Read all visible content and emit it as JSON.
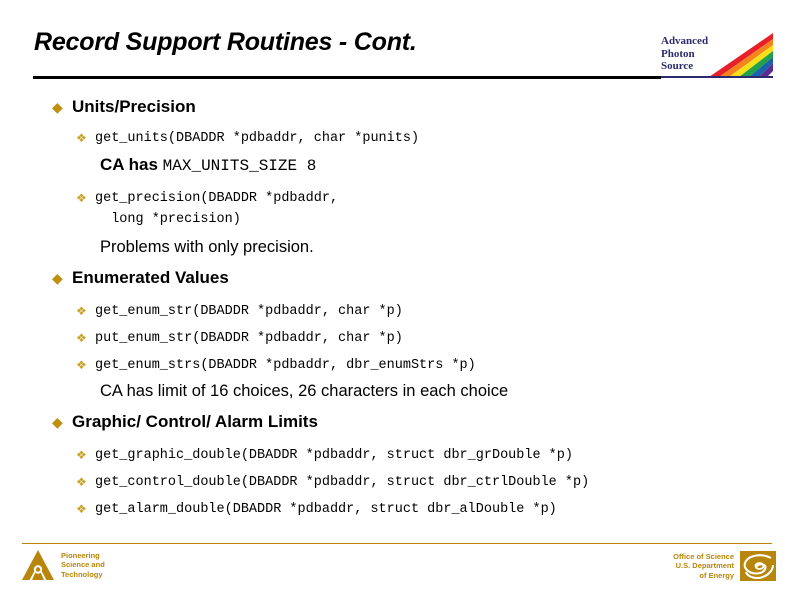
{
  "header": {
    "title": "Record Support Routines - Cont.",
    "logo": {
      "line1": "Advanced",
      "line2": "Photon",
      "line3": "Source",
      "icon": "aps-rainbow-icon"
    }
  },
  "bullets": {
    "level1_glyph": "◆",
    "level2_glyph": "❖",
    "level1_color": "#bf8f10",
    "level2_color": "#c9a227"
  },
  "sections": [
    {
      "heading": "Units/Precision",
      "items": [
        {
          "type": "code",
          "text": "get_units(DBADDR *pdbaddr, char *punits)"
        },
        {
          "type": "note-mixed",
          "lead": "CA has ",
          "mono": "MAX_UNITS_SIZE 8"
        },
        {
          "type": "code-wrap",
          "text": "get_precision(DBADDR *pdbaddr,\n  long *precision)"
        },
        {
          "type": "note",
          "text": "Problems with only precision."
        }
      ]
    },
    {
      "heading": "Enumerated Values",
      "items": [
        {
          "type": "code",
          "text": "get_enum_str(DBADDR *pdbaddr, char *p)"
        },
        {
          "type": "code",
          "text": "put_enum_str(DBADDR *pdbaddr, char *p)"
        },
        {
          "type": "code",
          "text": "get_enum_strs(DBADDR *pdbaddr, dbr_enumStrs *p)"
        },
        {
          "type": "note",
          "text": "CA has limit of 16 choices, 26 characters in each choice"
        }
      ]
    },
    {
      "heading": "Graphic/ Control/ Alarm Limits",
      "items": [
        {
          "type": "code",
          "text": "get_graphic_double(DBADDR *pdbaddr, struct dbr_grDouble *p)"
        },
        {
          "type": "code",
          "text": "get_control_double(DBADDR *pdbaddr, struct dbr_ctrlDouble *p)"
        },
        {
          "type": "code",
          "text": "get_alarm_double(DBADDR *pdbaddr, struct dbr_alDouble *p)"
        }
      ]
    }
  ],
  "footer": {
    "argonne": {
      "icon": "argonne-a-icon",
      "text": "Pioneering\nScience and\nTechnology"
    },
    "doe": {
      "icon": "doe-swirl-icon",
      "text": "Office of Science\nU.S. Department\nof Energy"
    },
    "accent_color": "#b8860b"
  }
}
